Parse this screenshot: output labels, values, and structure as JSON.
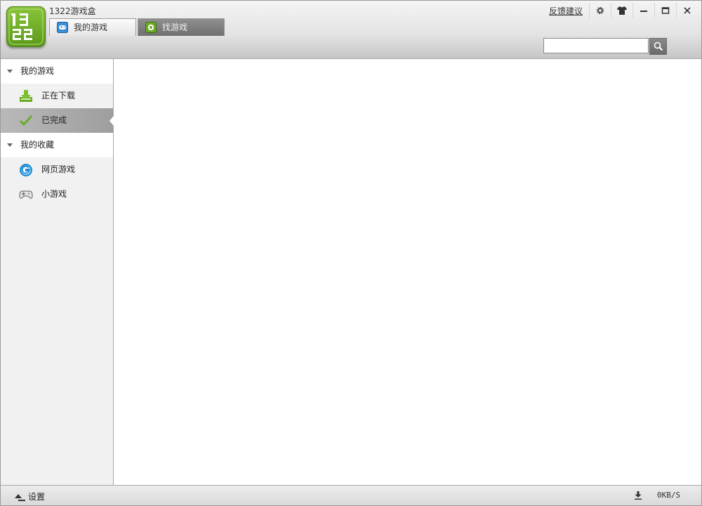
{
  "app": {
    "title": "1322游戏盒",
    "logo_text": "1322"
  },
  "tabs": [
    {
      "label": "我的游戏",
      "active": true
    },
    {
      "label": "找游戏",
      "active": false
    }
  ],
  "titlebar": {
    "feedback_label": "反馈建议",
    "buttons": [
      "gear-icon",
      "shirt-icon",
      "minimize-icon",
      "maximize-icon",
      "close-icon"
    ]
  },
  "search": {
    "value": "",
    "placeholder": ""
  },
  "sidebar": {
    "sections": [
      {
        "title": "我的游戏",
        "items": [
          {
            "label": "正在下载",
            "icon": "download-icon",
            "selected": false
          },
          {
            "label": "已完成",
            "icon": "check-icon",
            "selected": true
          }
        ]
      },
      {
        "title": "我的收藏",
        "items": [
          {
            "label": "网页游戏",
            "icon": "web-game-icon",
            "selected": false
          },
          {
            "label": "小游戏",
            "icon": "gamepad-icon",
            "selected": false
          }
        ]
      }
    ]
  },
  "statusbar": {
    "settings_label": "设置",
    "speed": "0KB/S"
  },
  "colors": {
    "accent_green": "#6aac24",
    "selected_bg": "#a9a9a9",
    "tab_inactive": "#7f7f7f"
  }
}
